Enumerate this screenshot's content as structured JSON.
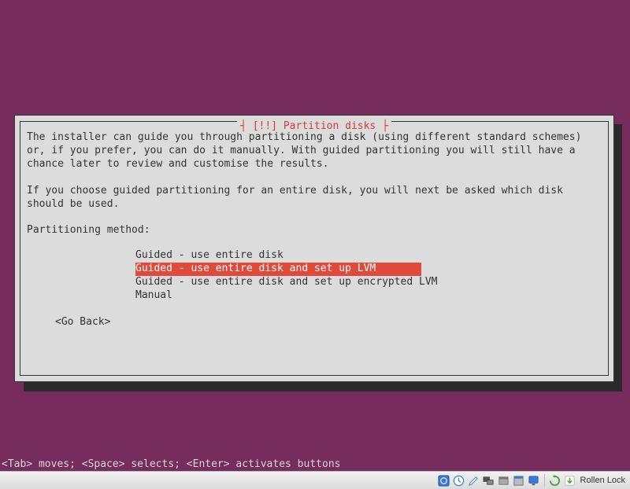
{
  "dialog": {
    "title": "[!!] Partition disks",
    "paragraph1": "The installer can guide you through partitioning a disk (using different standard schemes) or, if you prefer, you can do it manually. With guided partitioning you will still have a chance later to review and customise the results.",
    "paragraph2": "If you choose guided partitioning for an entire disk, you will next be asked which disk should be used.",
    "method_label": "Partitioning method:",
    "options": [
      "Guided - use entire disk",
      "Guided - use entire disk and set up LVM",
      "Guided - use entire disk and set up encrypted LVM",
      "Manual"
    ],
    "selected_index": 1,
    "go_back": "<Go Back>"
  },
  "statusbar": "<Tab> moves; <Space> selects; <Enter> activates buttons",
  "taskbar": {
    "label": "Rollen Lock"
  }
}
